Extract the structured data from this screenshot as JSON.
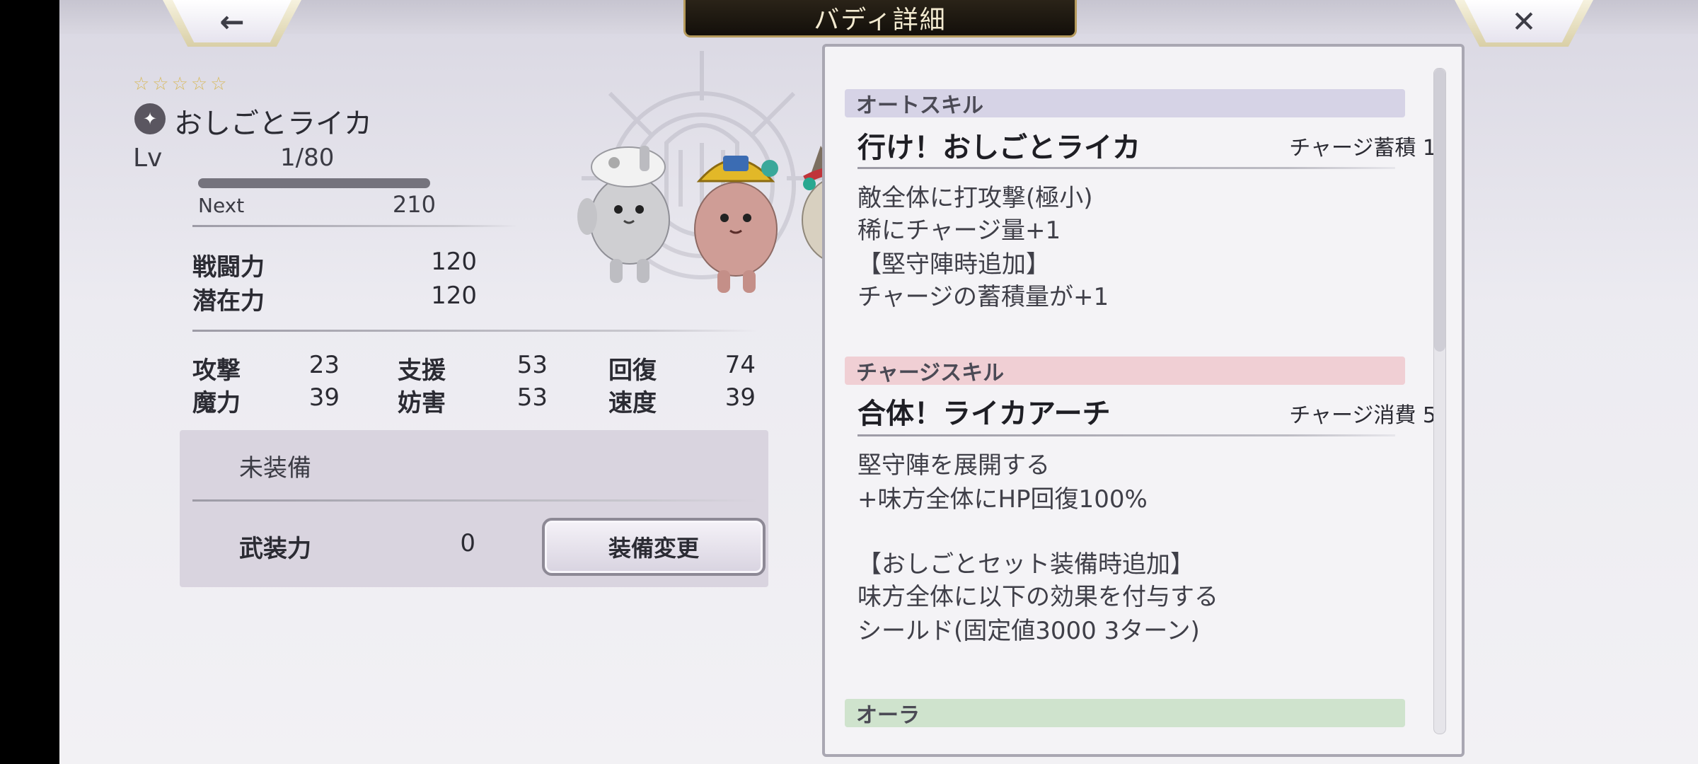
{
  "header": {
    "title": "バディ詳細",
    "back_glyph": "←",
    "close_glyph": "✕"
  },
  "buddy": {
    "rarity_stars": "☆☆☆☆☆",
    "type_icon": "sparkle-icon",
    "name": "おしごとライカ",
    "lv_label": "Lv",
    "lv_value": "1/80",
    "exp_progress": 0.0,
    "next_label": "Next",
    "next_value": "210",
    "combat_power_label": "戦闘力",
    "combat_power_value": "120",
    "potential_label": "潜在力",
    "potential_value": "120"
  },
  "stats": [
    {
      "label": "攻撃",
      "value": "23"
    },
    {
      "label": "支援",
      "value": "53"
    },
    {
      "label": "回復",
      "value": "74"
    },
    {
      "label": "魔力",
      "value": "39"
    },
    {
      "label": "妨害",
      "value": "53"
    },
    {
      "label": "速度",
      "value": "39"
    }
  ],
  "equipment": {
    "status": "未装備",
    "armed_power_label": "武装力",
    "armed_power_value": "0",
    "change_button": "装備変更"
  },
  "skills": {
    "auto": {
      "header": "オートスキル",
      "name": "行け！おしごとライカ",
      "meta": "チャージ蓄積 1",
      "lines": [
        "敵全体に打攻撃(極小)",
        "稀にチャージ量+1",
        "【堅守陣時追加】",
        "チャージの蓄積量が+1"
      ]
    },
    "charge": {
      "header": "チャージスキル",
      "name": "合体！ライカアーチ",
      "meta": "チャージ消費 5",
      "lines": [
        "堅守陣を展開する",
        "+味方全体にHP回復100%",
        "",
        "【おしごとセット装備時追加】",
        "味方全体に以下の効果を付与する",
        "シールド(固定値3000 3ターン)"
      ]
    },
    "aura": {
      "header": "オーラ"
    }
  },
  "colors": {
    "auto_header_bg": "#d6d3e6",
    "charge_header_bg": "#f0cfd4",
    "aura_header_bg": "#cfe3cd"
  }
}
